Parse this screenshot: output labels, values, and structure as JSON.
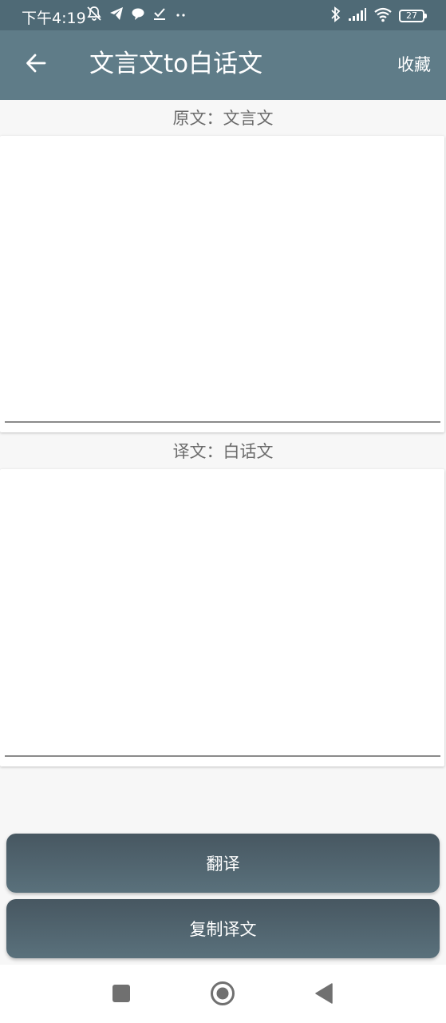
{
  "status_bar": {
    "time": "下午4:19",
    "battery_level": "27",
    "left_icons": [
      "mute-bell-icon",
      "telegram-icon",
      "chat-bubble-icon",
      "download-done-icon",
      "more-dots-icon"
    ],
    "right_icons": [
      "bluetooth-icon",
      "signal-icon",
      "wifi-icon",
      "battery-icon"
    ]
  },
  "app_bar": {
    "back_icon": "arrow-left-icon",
    "title": "文言文to白话文",
    "favorite_label": "收藏"
  },
  "source_section": {
    "label": "原文：文言文",
    "value": "",
    "placeholder": ""
  },
  "target_section": {
    "label": "译文：白话文",
    "value": "",
    "placeholder": ""
  },
  "actions": {
    "translate_label": "翻译",
    "copy_label": "复制译文"
  },
  "nav_bar": {
    "icons": [
      "recents-square-icon",
      "home-circle-icon",
      "back-triangle-icon"
    ]
  },
  "colors": {
    "status_bar": "#4f6a76",
    "app_bar": "#5f7c88",
    "button_top": "#475761",
    "button_bottom": "#5a717c",
    "background": "#f7f7f7"
  }
}
